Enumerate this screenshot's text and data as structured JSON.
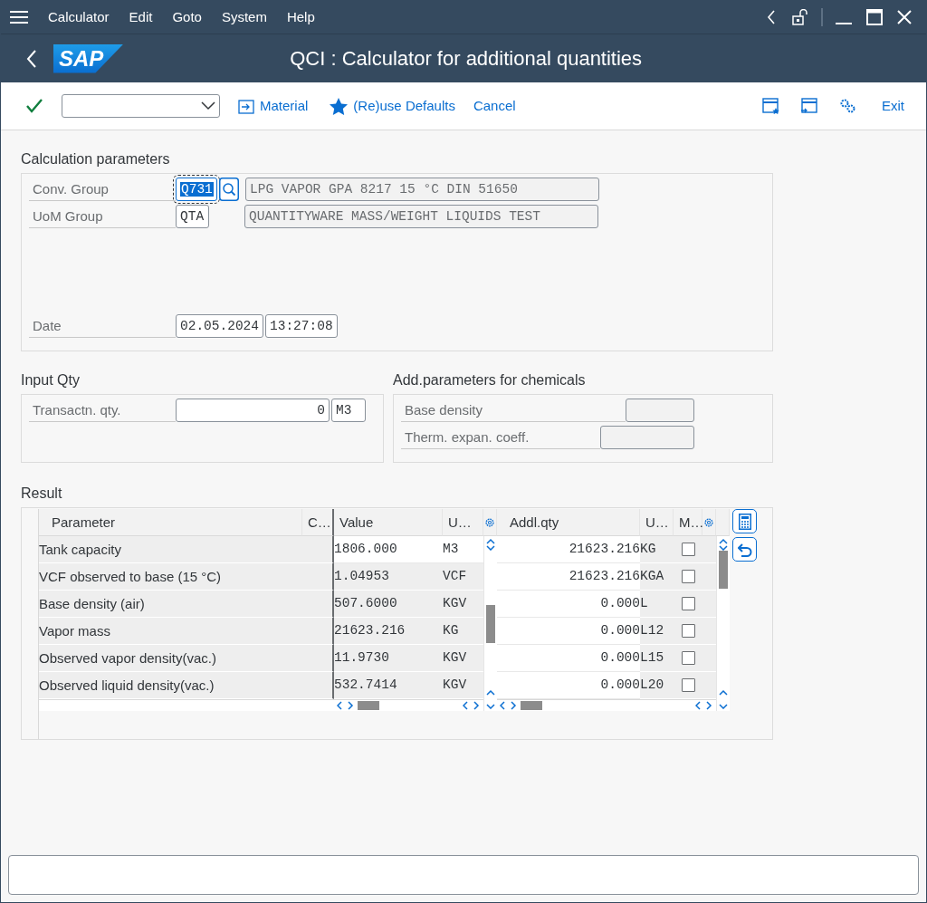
{
  "menu_bar": {
    "items": [
      "Calculator",
      "Edit",
      "Goto",
      "System",
      "Help"
    ]
  },
  "header": {
    "logo_text": "SAP",
    "title": "QCI : Calculator for additional quantities"
  },
  "toolbar": {
    "buttons": [
      {
        "kind": "material",
        "label": "Material"
      },
      {
        "kind": "defaults",
        "label": "(Re)use Defaults"
      },
      {
        "kind": "plain",
        "label": "Cancel"
      }
    ],
    "exit_label": "Exit"
  },
  "calculation_parameters": {
    "title": "Calculation parameters",
    "fields": [
      {
        "label": "Conv. Group",
        "code": "Q731",
        "description": "LPG VAPOR GPA 8217 15 °C DIN 51650",
        "focused": true
      },
      {
        "label": "UoM Group",
        "code": "QTA",
        "description": "QUANTITYWARE MASS/WEIGHT LIQUIDS TEST",
        "focused": false
      }
    ],
    "date": {
      "label": "Date",
      "date": "02.05.2024",
      "time": "13:27:08"
    }
  },
  "input_qty": {
    "title": "Input Qty",
    "label": "Transactn. qty.",
    "value": "0",
    "unit": "M3"
  },
  "chemicals": {
    "title": "Add.parameters for chemicals",
    "fields": [
      {
        "label": "Base density"
      },
      {
        "label": "Therm. expan. coeff."
      }
    ]
  },
  "result": {
    "title": "Result",
    "left_columns": [
      "Parameter",
      "C…",
      "Value",
      "U…"
    ],
    "right_columns": [
      "Addl.qty",
      "U…",
      "M…"
    ],
    "left_rows": [
      {
        "parameter": "Tank capacity",
        "value": "1806.000",
        "unit": "M3",
        "editable": true
      },
      {
        "parameter": "VCF observed to base (15 °C)",
        "value": "1.04953",
        "unit": "VCF",
        "editable": false
      },
      {
        "parameter": "Base density (air)",
        "value": "507.6000",
        "unit": "KGV",
        "editable": false
      },
      {
        "parameter": "Vapor mass",
        "value": "21623.216",
        "unit": "KG",
        "editable": false
      },
      {
        "parameter": "Observed  vapor density(vac.)",
        "value": "11.9730",
        "unit": "KGV",
        "editable": false
      },
      {
        "parameter": "Observed liquid density(vac.)",
        "value": "532.7414",
        "unit": "KGV",
        "editable": false
      }
    ],
    "right_rows": [
      {
        "quantity": "21623.216",
        "unit": "KG",
        "checked": false
      },
      {
        "quantity": "21623.216",
        "unit": "KGA",
        "checked": false
      },
      {
        "quantity": "0.000",
        "unit": "L",
        "checked": false
      },
      {
        "quantity": "0.000",
        "unit": "L12",
        "checked": false
      },
      {
        "quantity": "0.000",
        "unit": "L15",
        "checked": false
      },
      {
        "quantity": "0.000",
        "unit": "L20",
        "checked": false
      }
    ]
  }
}
